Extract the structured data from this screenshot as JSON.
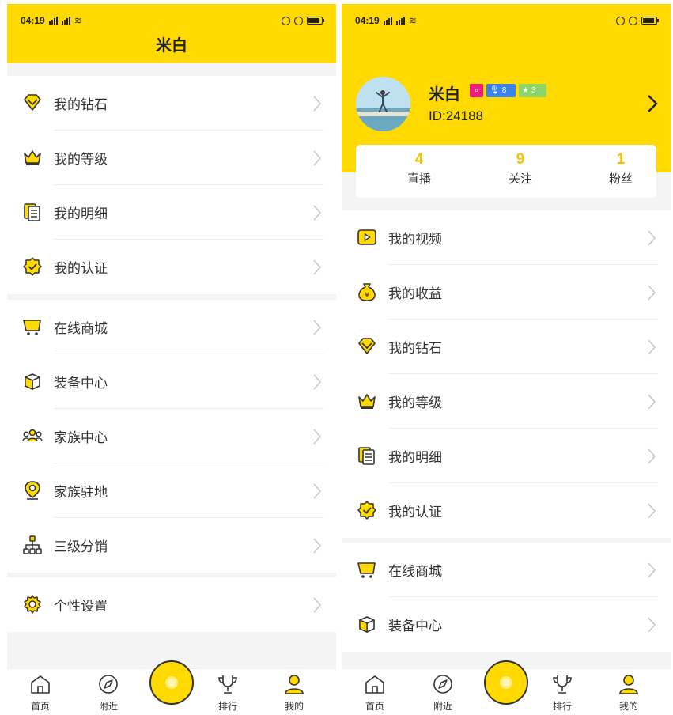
{
  "status": {
    "time": "04:19"
  },
  "left": {
    "title": "米白",
    "group1": [
      {
        "label": "我的钻石",
        "icon": "diamond-icon"
      },
      {
        "label": "我的等级",
        "icon": "crown-icon"
      },
      {
        "label": "我的明细",
        "icon": "document-list-icon"
      },
      {
        "label": "我的认证",
        "icon": "verified-badge-icon"
      }
    ],
    "group2": [
      {
        "label": "在线商城",
        "icon": "shopping-cart-icon"
      },
      {
        "label": "装备中心",
        "icon": "box-icon"
      },
      {
        "label": "家族中心",
        "icon": "group-icon"
      },
      {
        "label": "家族驻地",
        "icon": "location-pin-icon"
      },
      {
        "label": "三级分销",
        "icon": "hierarchy-icon"
      }
    ],
    "group3": [
      {
        "label": "个性设置",
        "icon": "gear-icon"
      }
    ]
  },
  "right": {
    "profile": {
      "name": "米白",
      "id_text": "ID:24188",
      "badges": {
        "mic_level": "8",
        "star_level": "3"
      }
    },
    "stats": [
      {
        "value": "4",
        "label": "直播"
      },
      {
        "value": "9",
        "label": "关注"
      },
      {
        "value": "1",
        "label": "粉丝"
      }
    ],
    "group1": [
      {
        "label": "我的视频",
        "icon": "video-icon"
      },
      {
        "label": "我的收益",
        "icon": "money-bag-icon"
      },
      {
        "label": "我的钻石",
        "icon": "diamond-icon"
      },
      {
        "label": "我的等级",
        "icon": "crown-icon"
      },
      {
        "label": "我的明细",
        "icon": "document-list-icon"
      },
      {
        "label": "我的认证",
        "icon": "verified-badge-icon"
      }
    ],
    "group2": [
      {
        "label": "在线商城",
        "icon": "shopping-cart-icon"
      },
      {
        "label": "装备中心",
        "icon": "box-icon"
      }
    ]
  },
  "tabbar": [
    {
      "label": "首页",
      "icon": "home-icon"
    },
    {
      "label": "附近",
      "icon": "compass-icon"
    },
    {
      "label": "",
      "icon": "live-center-icon"
    },
    {
      "label": "排行",
      "icon": "trophy-icon"
    },
    {
      "label": "我的",
      "icon": "person-icon"
    }
  ],
  "colors": {
    "accent": "#ffd900",
    "stat_number": "#f2c200"
  }
}
